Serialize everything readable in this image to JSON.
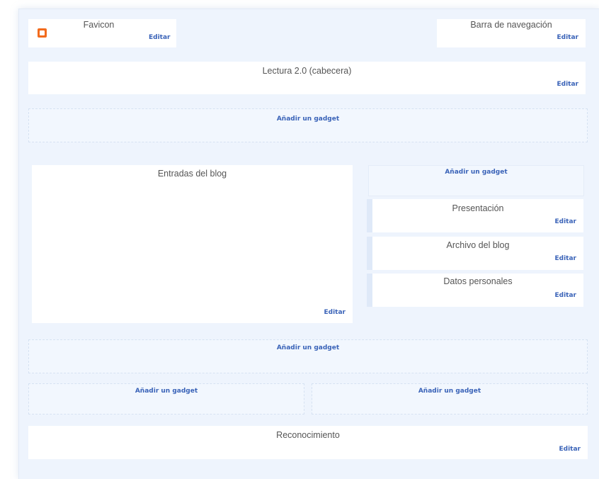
{
  "widgets": {
    "favicon": {
      "title": "Favicon",
      "edit": "Editar"
    },
    "navbar": {
      "title": "Barra de navegación",
      "edit": "Editar"
    },
    "header": {
      "title": "Lectura 2.0 (cabecera)",
      "edit": "Editar"
    },
    "posts": {
      "title": "Entradas del blog",
      "edit": "Editar"
    },
    "presentation": {
      "title": "Presentación",
      "edit": "Editar"
    },
    "archive": {
      "title": "Archivo del blog",
      "edit": "Editar"
    },
    "profile": {
      "title": "Datos personales",
      "edit": "Editar"
    },
    "attribution": {
      "title": "Reconocimiento",
      "edit": "Editar"
    }
  },
  "add_gadget_label": "Añadir un gadget",
  "colors": {
    "layout_bg": "#eef4fd",
    "widget_bg": "#ffffff",
    "link": "#3a63b8",
    "title_text": "#555555",
    "blogger_orange": "#f26b1d"
  },
  "icons": [
    "blogger-icon"
  ]
}
